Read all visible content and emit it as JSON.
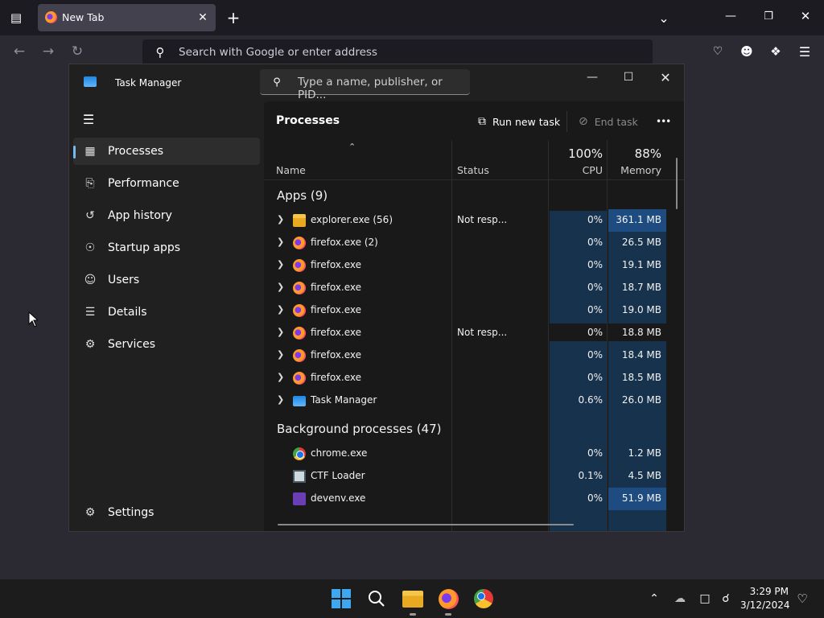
{
  "browser": {
    "tab_title": "New Tab",
    "new_tab_label": "+",
    "address_placeholder": "Search with Google or enter address"
  },
  "task_manager": {
    "title": "Task Manager",
    "search_placeholder": "Type a name, publisher, or PID...",
    "sidebar": {
      "items": [
        {
          "label": "Processes",
          "icon": "processes-icon"
        },
        {
          "label": "Performance",
          "icon": "performance-icon"
        },
        {
          "label": "App history",
          "icon": "app-history-icon"
        },
        {
          "label": "Startup apps",
          "icon": "startup-apps-icon"
        },
        {
          "label": "Users",
          "icon": "users-icon"
        },
        {
          "label": "Details",
          "icon": "details-icon"
        },
        {
          "label": "Services",
          "icon": "services-icon"
        }
      ],
      "settings_label": "Settings"
    },
    "panel": {
      "title": "Processes",
      "run_new_task": "Run new task",
      "end_task": "End task",
      "more": "•••"
    },
    "columns": {
      "name": "Name",
      "status": "Status",
      "cpu_pct": "100%",
      "cpu": "CPU",
      "memory_pct": "88%",
      "memory": "Memory"
    },
    "groups": {
      "apps": "Apps (9)",
      "background": "Background processes (47)"
    },
    "apps": [
      {
        "name": "explorer.exe (56)",
        "status": "Not resp...",
        "cpu": "0%",
        "memory": "361.1 MB",
        "icon": "folder"
      },
      {
        "name": "firefox.exe (2)",
        "status": "",
        "cpu": "0%",
        "memory": "26.5 MB",
        "icon": "firefox"
      },
      {
        "name": "firefox.exe",
        "status": "",
        "cpu": "0%",
        "memory": "19.1 MB",
        "icon": "firefox"
      },
      {
        "name": "firefox.exe",
        "status": "",
        "cpu": "0%",
        "memory": "18.7 MB",
        "icon": "firefox"
      },
      {
        "name": "firefox.exe",
        "status": "",
        "cpu": "0%",
        "memory": "19.0 MB",
        "icon": "firefox"
      },
      {
        "name": "firefox.exe",
        "status": "Not resp...",
        "cpu": "0%",
        "memory": "18.8 MB",
        "icon": "firefox"
      },
      {
        "name": "firefox.exe",
        "status": "",
        "cpu": "0%",
        "memory": "18.4 MB",
        "icon": "firefox"
      },
      {
        "name": "firefox.exe",
        "status": "",
        "cpu": "0%",
        "memory": "18.5 MB",
        "icon": "firefox"
      },
      {
        "name": "Task Manager",
        "status": "",
        "cpu": "0.6%",
        "memory": "26.0 MB",
        "icon": "taskmanager"
      }
    ],
    "background": [
      {
        "name": "chrome.exe",
        "status": "",
        "cpu": "0%",
        "memory": "1.2 MB",
        "icon": "chrome"
      },
      {
        "name": "CTF Loader",
        "status": "",
        "cpu": "0.1%",
        "memory": "4.5 MB",
        "icon": "ctf"
      },
      {
        "name": "devenv.exe",
        "status": "",
        "cpu": "0%",
        "memory": "51.9 MB",
        "icon": "vs"
      }
    ]
  },
  "taskbar": {
    "time": "3:29 PM",
    "date": "3/12/2024"
  }
}
